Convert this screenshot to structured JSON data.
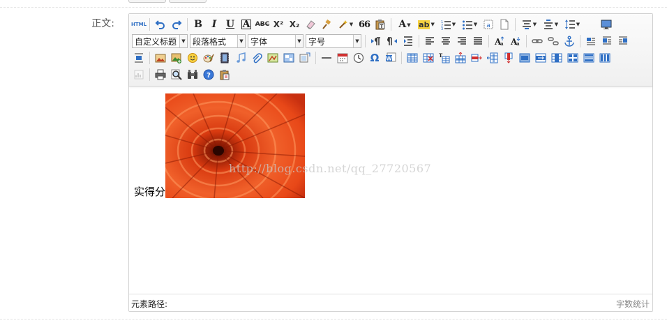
{
  "form": {
    "field_label": "正文:"
  },
  "toolbar": {
    "html_button": "HTML",
    "bold": "B",
    "italic": "I",
    "underline": "U",
    "fontborder": "A",
    "strikethrough": "ABC",
    "superscript": "X²",
    "subscript": "X₂",
    "blockquote": "66",
    "forecolor": "A",
    "backcolor": "ab",
    "omega": "Ω",
    "selects": {
      "custom_style": "自定义标题",
      "paragraph": "段落格式",
      "font_family": "字体",
      "font_size": "字号"
    }
  },
  "content": {
    "text": "实得分",
    "watermark": "http://blog.csdn.net/qq_27720567"
  },
  "status": {
    "element_path": "元素路径:",
    "word_count": "字数统计"
  },
  "colors": {
    "accent_blue": "#2f6fc4",
    "flower_orange": "#e8461a",
    "border": "#d4d4d4"
  }
}
